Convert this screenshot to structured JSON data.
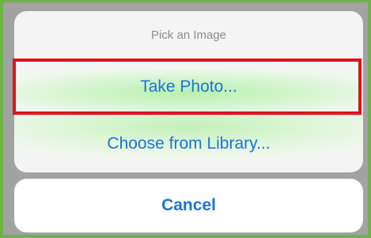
{
  "action_sheet": {
    "title": "Pick an Image",
    "options": [
      {
        "label": "Take Photo..."
      },
      {
        "label": "Choose from Library..."
      }
    ],
    "cancel_label": "Cancel"
  },
  "colors": {
    "border": "#6fb24a",
    "backdrop": "#a2a2a2",
    "sheet": "#f4f4f4",
    "link": "#1a73d9",
    "highlight_box": "#e0121b",
    "glow": "#b8f0b0"
  }
}
